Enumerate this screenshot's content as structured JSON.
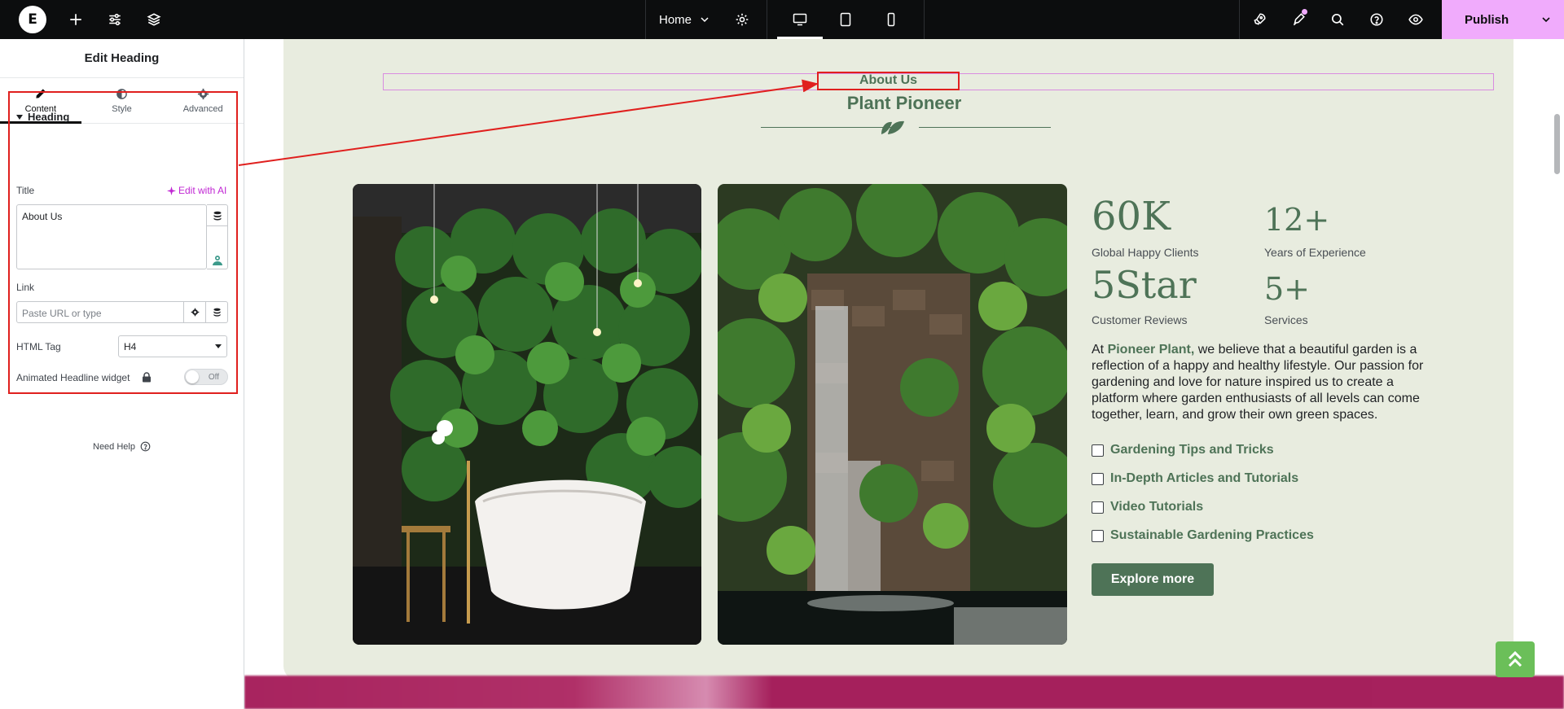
{
  "topbar": {
    "page_name": "Home",
    "publish_label": "Publish"
  },
  "panel": {
    "title": "Edit Heading",
    "tabs": [
      {
        "label": "Content"
      },
      {
        "label": "Style"
      },
      {
        "label": "Advanced"
      }
    ],
    "section_title": "Heading",
    "title_label": "Title",
    "edit_ai_label": "Edit with AI",
    "title_value": "About Us",
    "link_label": "Link",
    "link_placeholder": "Paste URL or type",
    "html_tag_label": "HTML Tag",
    "html_tag_value": "H4",
    "animated_label": "Animated Headline widget",
    "toggle_label": "Off",
    "need_help": "Need Help"
  },
  "canvas": {
    "about": "About Us",
    "title": "Plant Pioneer",
    "stats": [
      {
        "value": "60K",
        "label": "Global Happy Clients"
      },
      {
        "value": "12+",
        "label": "Years of Experience"
      },
      {
        "value": "5Star",
        "label": "Customer Reviews"
      },
      {
        "value": "5+",
        "label": "Services"
      }
    ],
    "para_prefix": "At ",
    "para_highlight": "Pioneer Plant,",
    "para_rest": " we believe that a beautiful garden is a reflection of a happy and healthy lifestyle. Our passion for gardening and love for nature inspired us to create a platform where garden enthusiasts of all levels can come together, learn, and grow their own green spaces.",
    "checklist": [
      "Gardening Tips and Tricks",
      "In-Depth Articles and Tutorials",
      "Video Tutorials",
      "Sustainable Gardening Practices"
    ],
    "button_label": "Explore more"
  },
  "colors": {
    "brand_green": "#4e7357",
    "card_bg": "#e8ecdf",
    "publish_bg": "#f0abfc",
    "highlight_red": "#e0201e"
  }
}
